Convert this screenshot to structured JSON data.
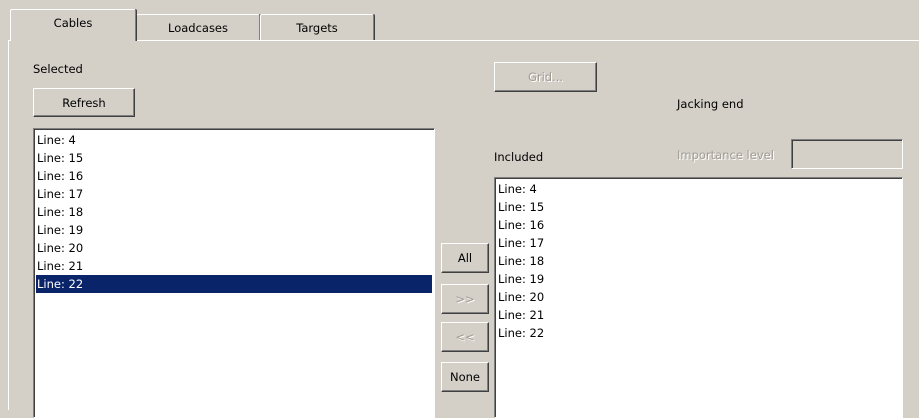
{
  "tabs": [
    {
      "label": "Cables",
      "active": true
    },
    {
      "label": "Loadcases",
      "active": false
    },
    {
      "label": "Targets",
      "active": false
    }
  ],
  "selected_label": "Selected",
  "refresh_button": "Refresh",
  "grid_button": "Grid...",
  "jacking_end_label": "Jacking end",
  "importance_level_label": "Importance level",
  "importance_level_value": "",
  "included_label": "Included",
  "transfer_buttons": {
    "all": "All",
    "add": ">>",
    "remove": "<<",
    "none": "None"
  },
  "selected_list": {
    "items": [
      "Line: 4",
      "Line: 15",
      "Line: 16",
      "Line: 17",
      "Line: 18",
      "Line: 19",
      "Line: 20",
      "Line: 21",
      "Line: 22"
    ],
    "selected_item": "Line: 22"
  },
  "included_list": {
    "items": [
      "Line: 4",
      "Line: 15",
      "Line: 16",
      "Line: 17",
      "Line: 18",
      "Line: 19",
      "Line: 20",
      "Line: 21",
      "Line: 22"
    ]
  },
  "colors": {
    "background": "#d4d0c8",
    "selection": "#0a246a",
    "disabled_text": "#a09c94"
  }
}
